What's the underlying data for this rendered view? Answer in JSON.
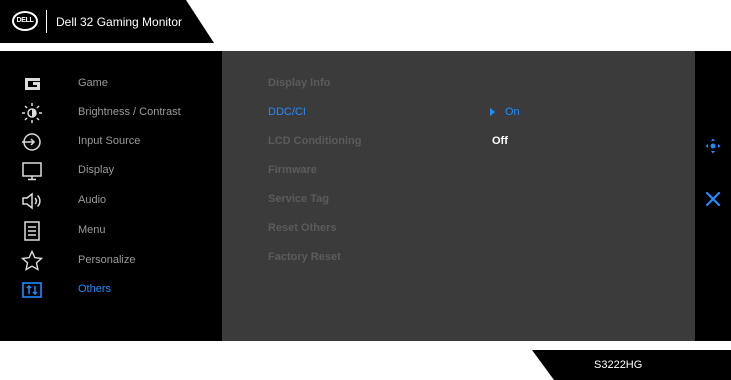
{
  "header": {
    "logo_text": "DELL",
    "title": "Dell 32 Gaming Monitor"
  },
  "sidebar": {
    "items": [
      {
        "label": "Game",
        "icon": "game-icon"
      },
      {
        "label": "Brightness / Contrast",
        "icon": "brightness-icon"
      },
      {
        "label": "Input Source",
        "icon": "input-source-icon"
      },
      {
        "label": "Display",
        "icon": "display-icon"
      },
      {
        "label": "Audio",
        "icon": "speaker-icon"
      },
      {
        "label": "Menu",
        "icon": "menu-icon"
      },
      {
        "label": "Personalize",
        "icon": "star-icon"
      },
      {
        "label": "Others",
        "icon": "others-icon",
        "active": true
      }
    ]
  },
  "submenu": {
    "items": [
      {
        "label": "Display Info"
      },
      {
        "label": "DDC/CI",
        "active": true
      },
      {
        "label": "LCD Conditioning"
      },
      {
        "label": "Firmware"
      },
      {
        "label": "Service Tag"
      },
      {
        "label": "Reset Others"
      },
      {
        "label": "Factory Reset"
      }
    ]
  },
  "options": {
    "on_label": "On",
    "off_label": "Off",
    "selected": "On"
  },
  "nav": {
    "joystick_icon": "joystick-icon",
    "close_icon": "close-icon"
  },
  "model": "S3222HG",
  "colors": {
    "accent": "#1f8cff",
    "panel": "#000000",
    "submenu_bg": "#3b3b3b",
    "inactive_text": "#9a9a9a",
    "dim_text": "#5b5b5b"
  }
}
